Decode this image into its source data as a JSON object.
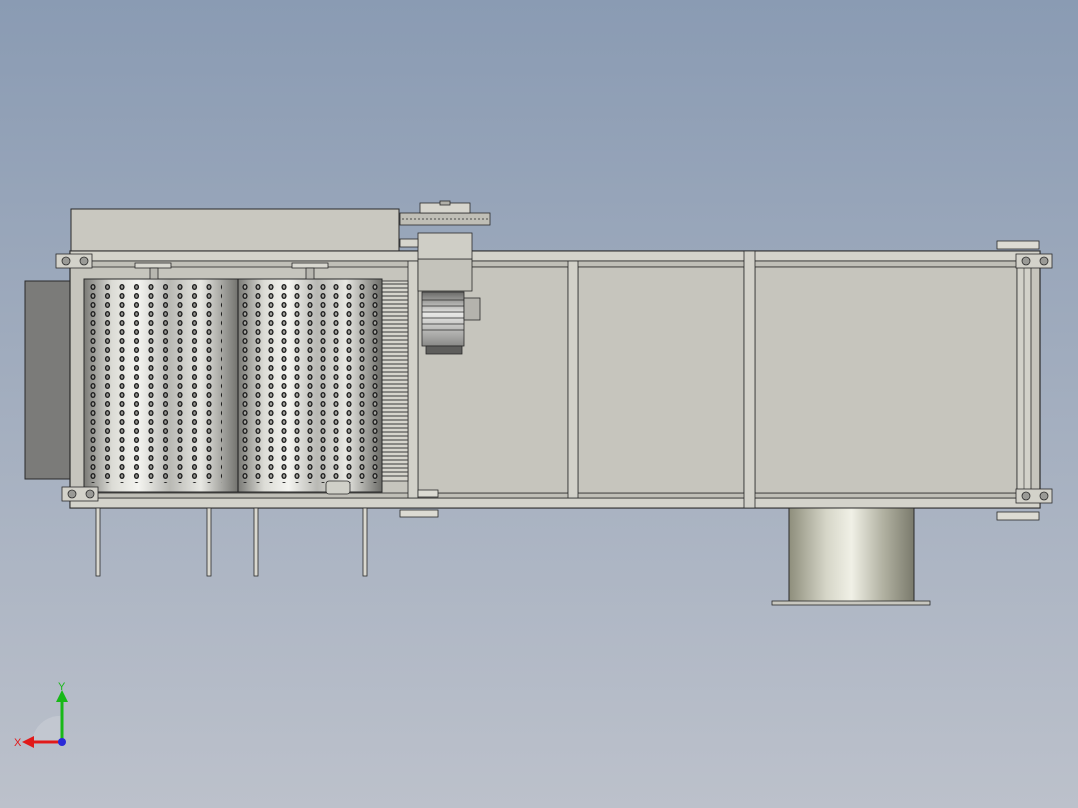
{
  "viewport": {
    "background_top": "#8a9bb3",
    "background_bottom": "#bcc1cb"
  },
  "model": {
    "frame_color": "#c6c5bd",
    "edge_color": "#2a2a2a",
    "steel_light": "#eeeeea",
    "steel_dark": "#6e6e6a",
    "panel_dark": "#7a7a78",
    "motor_color": "#9b9b99",
    "components": [
      "frame",
      "control-box",
      "drum-left",
      "drum-right",
      "gear-motor",
      "sprocket",
      "outlet-pipe",
      "support-legs",
      "corner-bearings"
    ]
  },
  "triad": {
    "x_label": "X",
    "y_label": "Y",
    "x_color": "#e11a1a",
    "y_color": "#18b818",
    "z_color": "#2a2ad8"
  }
}
